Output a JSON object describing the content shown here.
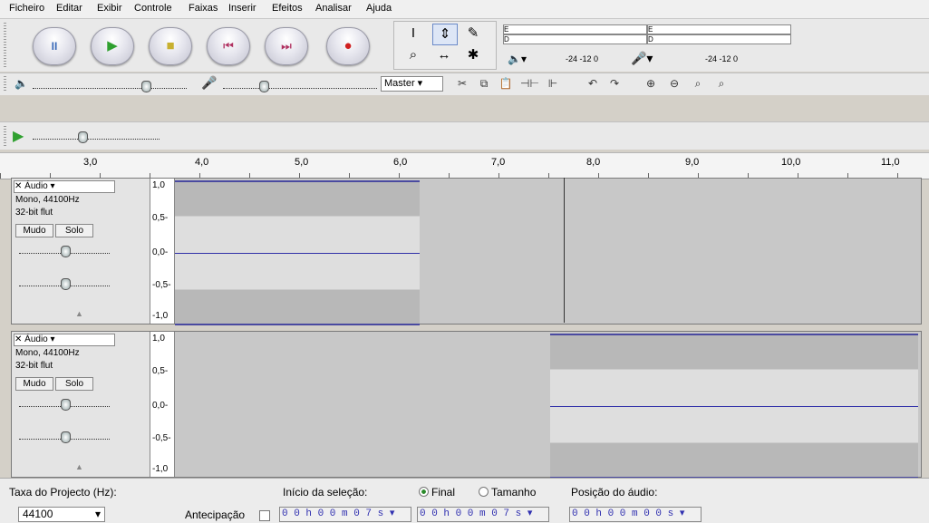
{
  "menu": [
    "Ficheiro",
    "Editar",
    "Exibir",
    "Controle",
    "Faixas",
    "Inserir",
    "Efeitos",
    "Analisar",
    "Ajuda"
  ],
  "transport": {
    "pause": "II",
    "play": "▶",
    "stop": "■",
    "skip_start": "⏮",
    "skip_end": "⏭",
    "record": "●"
  },
  "tools": {
    "select": "I",
    "envelope": "⇕",
    "draw": "✎",
    "zoom": "⌕",
    "timeshift": "↔",
    "multi": "✱"
  },
  "meter": {
    "e": "E",
    "d": "D",
    "scale_text": "-24  -12  0"
  },
  "mixer": {
    "master_label": "Master"
  },
  "ruler": {
    "labels": [
      "3,0",
      "4,0",
      "5,0",
      "6,0",
      "7,0",
      "8,0",
      "9,0",
      "10,0",
      "11,0"
    ]
  },
  "tracks": [
    {
      "name": "Áudio",
      "info1": "Mono, 44100Hz",
      "info2": "32-bit flut",
      "mudo": "Mudo",
      "solo": "Solo",
      "scale": [
        "1,0",
        "0,5-",
        "0,0-",
        "-0,5-",
        "-1,0"
      ]
    },
    {
      "name": "Áudio",
      "info1": "Mono, 44100Hz",
      "info2": "32-bit flut",
      "mudo": "Mudo",
      "solo": "Solo",
      "scale": [
        "1,0",
        "0,5-",
        "0,0-",
        "-0,5-",
        "-1,0"
      ]
    }
  ],
  "status": {
    "rate_label": "Taxa do Projecto (Hz):",
    "rate_value": "44100",
    "antecipacao": "Antecipação",
    "inicio_label": "Início da seleção:",
    "final_label": "Final",
    "tamanho_label": "Tamanho",
    "posicao_label": "Posição do áudio:",
    "inicio_value": "0 0 h 0 0 m 0 7 s",
    "fim_value": "0 0 h 0 0 m 0 7 s",
    "posicao_value": "0 0 h 0 0 m 0 0 s"
  }
}
